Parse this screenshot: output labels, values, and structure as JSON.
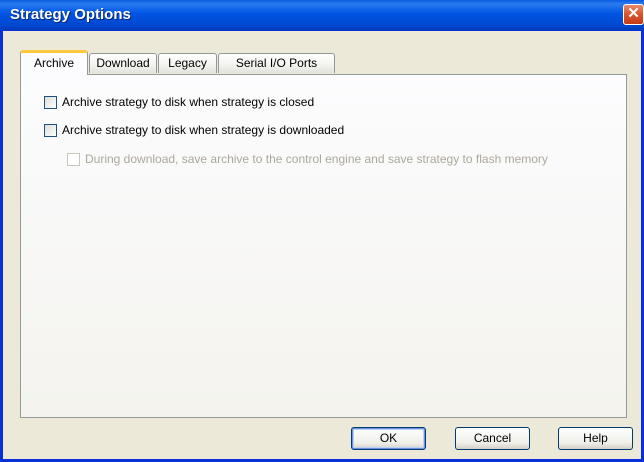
{
  "window": {
    "title": "Strategy Options",
    "close_icon": "close-icon"
  },
  "tabs": [
    {
      "label": "Archive",
      "active": true
    },
    {
      "label": "Download",
      "active": false
    },
    {
      "label": "Legacy",
      "active": false
    },
    {
      "label": "Serial I/O Ports",
      "active": false
    }
  ],
  "archive": {
    "option1": {
      "label": "Archive strategy to disk when strategy is closed",
      "checked": false
    },
    "option2": {
      "label": "Archive strategy to disk when strategy is downloaded",
      "checked": false
    },
    "option3": {
      "label": "During download, save archive to the control engine and save strategy to flash memory",
      "checked": false,
      "enabled": false
    }
  },
  "buttons": {
    "ok": "OK",
    "cancel": "Cancel",
    "help": "Help"
  },
  "colors": {
    "titlebar": "#0054E3",
    "active_tab_accent": "#FFC83C",
    "close_button": "#D9542C"
  }
}
